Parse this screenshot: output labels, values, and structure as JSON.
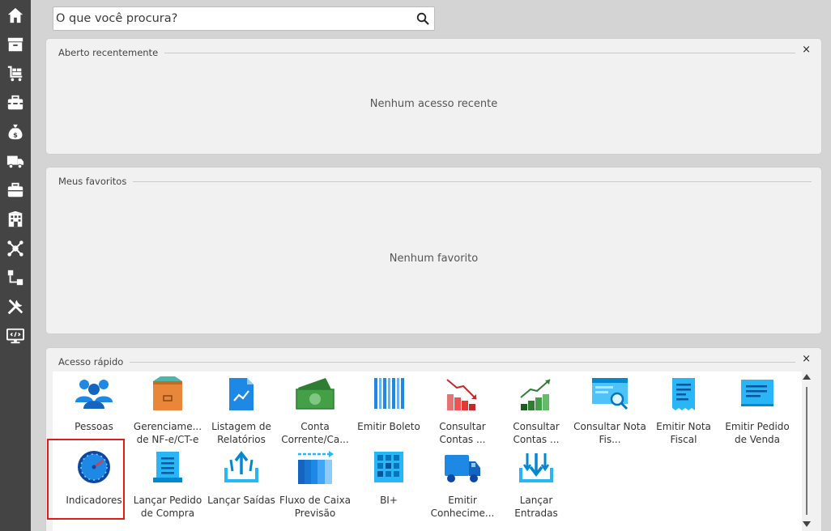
{
  "search": {
    "placeholder": "O que você procura?"
  },
  "sidebar": {
    "items": [
      {
        "icon": "home-icon"
      },
      {
        "icon": "archive-icon"
      },
      {
        "icon": "cart-icon"
      },
      {
        "icon": "toolbox-icon"
      },
      {
        "icon": "money-bag-icon"
      },
      {
        "icon": "truck-icon"
      },
      {
        "icon": "briefcase-icon"
      },
      {
        "icon": "building-icon"
      },
      {
        "icon": "network-icon"
      },
      {
        "icon": "flow-icon"
      },
      {
        "icon": "tools-icon"
      },
      {
        "icon": "code-monitor-icon"
      }
    ]
  },
  "recent": {
    "title": "Aberto recentemente",
    "empty": "Nenhum acesso recente",
    "close": "×"
  },
  "favorites": {
    "title": "Meus favoritos",
    "empty": "Nenhum favorito"
  },
  "quick": {
    "title": "Acesso rápido",
    "close": "×",
    "items": [
      {
        "label": "Pessoas",
        "icon": "people-icon"
      },
      {
        "label": "Gerenciame... de NF-e/CT-e",
        "icon": "box-icon"
      },
      {
        "label": "Listagem de Relatórios",
        "icon": "report-chart-icon"
      },
      {
        "label": "Conta Corrente/Ca...",
        "icon": "cash-icon"
      },
      {
        "label": "Emitir Boleto",
        "icon": "barcode-icon"
      },
      {
        "label": "Consultar Contas ...",
        "icon": "chart-down-icon"
      },
      {
        "label": "Consultar Contas ...",
        "icon": "chart-up-icon"
      },
      {
        "label": "Consultar Nota Fis...",
        "icon": "browser-search-icon"
      },
      {
        "label": "Emitir Nota Fiscal",
        "icon": "receipt-icon"
      },
      {
        "label": "Emitir Pedido de Venda",
        "icon": "monitor-list-icon"
      },
      {
        "label": "Indicadores",
        "icon": "speedometer-icon"
      },
      {
        "label": "Lançar Pedido de Compra",
        "icon": "document-list-icon"
      },
      {
        "label": "Lançar Saídas",
        "icon": "upload-arrows-icon"
      },
      {
        "label": "Fluxo de Caixa Previsão",
        "icon": "cashflow-bars-icon"
      },
      {
        "label": "BI+",
        "icon": "grid-bi-icon"
      },
      {
        "label": "Emitir Conhecime...",
        "icon": "truck-blue-icon"
      },
      {
        "label": "Lançar Entradas",
        "icon": "download-arrows-icon"
      }
    ]
  },
  "colors": {
    "sidebar": "#444444",
    "highlight": "#e01b1b",
    "accent": "#1e88e5"
  }
}
